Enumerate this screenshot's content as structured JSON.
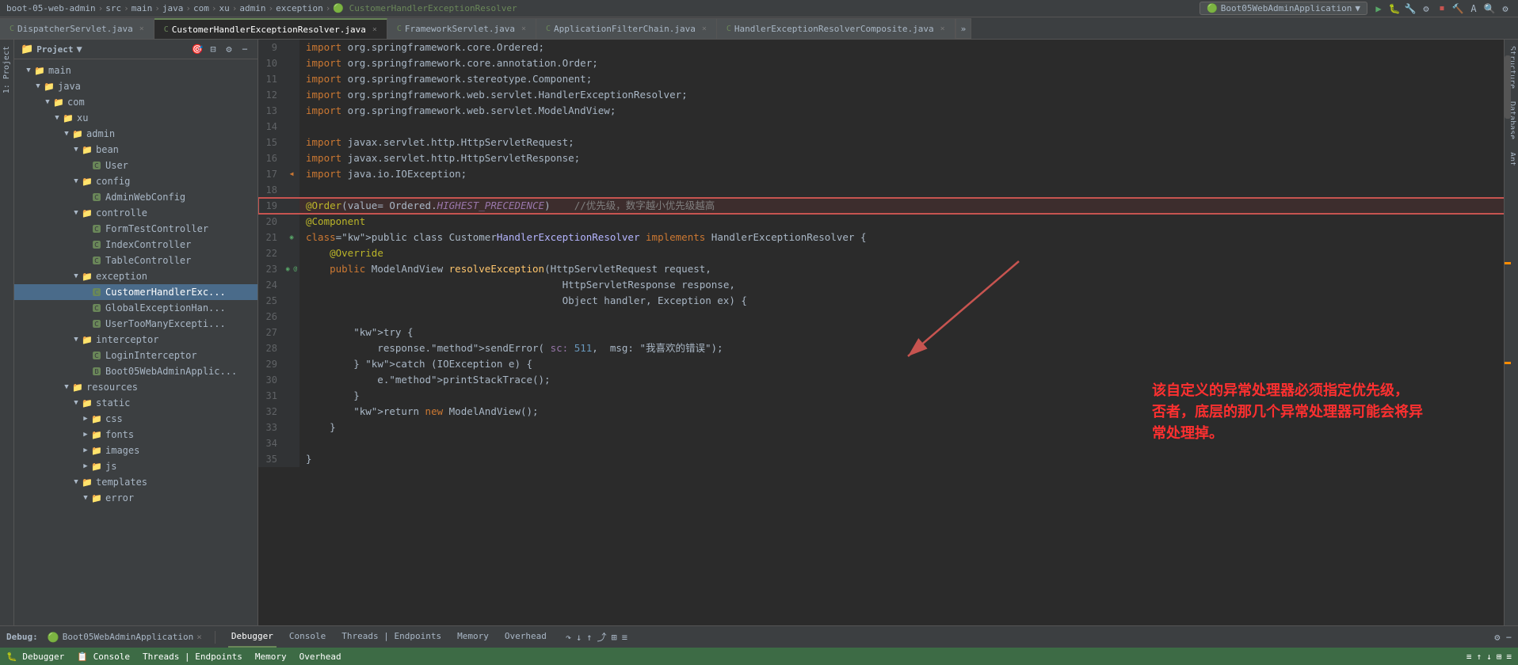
{
  "topbar": {
    "breadcrumb": [
      "boot-05-web-admin",
      "src",
      "main",
      "java",
      "com",
      "xu",
      "admin",
      "exception",
      "CustomerHandlerExceptionResolver"
    ],
    "run_config": "Boot05WebAdminApplication",
    "icons": [
      "▶",
      "⏸",
      "⏹",
      "↺",
      "⚙",
      "📋",
      "🔧",
      "🔍",
      "A"
    ]
  },
  "tabs": [
    {
      "label": "DispatcherServlet.java",
      "active": false,
      "icon": "C"
    },
    {
      "label": "CustomerHandlerExceptionResolver.java",
      "active": true,
      "icon": "C"
    },
    {
      "label": "FrameworkServlet.java",
      "active": false,
      "icon": "C"
    },
    {
      "label": "ApplicationFilterChain.java",
      "active": false,
      "icon": "C"
    },
    {
      "label": "HandlerExceptionResolverComposite.java",
      "active": false,
      "icon": "C"
    }
  ],
  "sidebar": {
    "title": "Project",
    "tree": [
      {
        "label": "main",
        "type": "folder",
        "indent": 1,
        "expanded": true,
        "arrow": "▼"
      },
      {
        "label": "java",
        "type": "folder",
        "indent": 2,
        "expanded": true,
        "arrow": "▼"
      },
      {
        "label": "com",
        "type": "folder",
        "indent": 3,
        "expanded": true,
        "arrow": "▼"
      },
      {
        "label": "xu",
        "type": "folder",
        "indent": 4,
        "expanded": true,
        "arrow": "▼"
      },
      {
        "label": "admin",
        "type": "folder",
        "indent": 5,
        "expanded": true,
        "arrow": "▼"
      },
      {
        "label": "bean",
        "type": "folder",
        "indent": 6,
        "expanded": true,
        "arrow": "▼"
      },
      {
        "label": "User",
        "type": "java-c",
        "indent": 7,
        "arrow": ""
      },
      {
        "label": "config",
        "type": "folder",
        "indent": 6,
        "expanded": true,
        "arrow": "▼"
      },
      {
        "label": "AdminWebConfig",
        "type": "java-c",
        "indent": 7,
        "arrow": ""
      },
      {
        "label": "controlle",
        "type": "folder",
        "indent": 6,
        "expanded": true,
        "arrow": "▼"
      },
      {
        "label": "FormTestController",
        "type": "java-c",
        "indent": 7,
        "arrow": ""
      },
      {
        "label": "IndexController",
        "type": "java-c",
        "indent": 7,
        "arrow": ""
      },
      {
        "label": "TableController",
        "type": "java-c",
        "indent": 7,
        "arrow": ""
      },
      {
        "label": "exception",
        "type": "folder",
        "indent": 6,
        "expanded": true,
        "arrow": "▼"
      },
      {
        "label": "CustomerHandlerExc...",
        "type": "java-c",
        "indent": 7,
        "arrow": "",
        "selected": true
      },
      {
        "label": "GlobalExceptionHan...",
        "type": "java-c",
        "indent": 7,
        "arrow": ""
      },
      {
        "label": "UserTooManyExcepti...",
        "type": "java-c",
        "indent": 7,
        "arrow": ""
      },
      {
        "label": "interceptor",
        "type": "folder",
        "indent": 6,
        "expanded": true,
        "arrow": "▼"
      },
      {
        "label": "LoginInterceptor",
        "type": "java-c",
        "indent": 7,
        "arrow": ""
      },
      {
        "label": "Boot05WebAdminApplic...",
        "type": "java-spring",
        "indent": 7,
        "arrow": ""
      },
      {
        "label": "resources",
        "type": "folder",
        "indent": 5,
        "expanded": true,
        "arrow": "▼"
      },
      {
        "label": "static",
        "type": "folder",
        "indent": 6,
        "expanded": true,
        "arrow": "▼"
      },
      {
        "label": "css",
        "type": "folder",
        "indent": 7,
        "expanded": false,
        "arrow": "▶"
      },
      {
        "label": "fonts",
        "type": "folder",
        "indent": 7,
        "expanded": false,
        "arrow": "▶"
      },
      {
        "label": "images",
        "type": "folder",
        "indent": 7,
        "expanded": false,
        "arrow": "▶"
      },
      {
        "label": "js",
        "type": "folder",
        "indent": 7,
        "expanded": false,
        "arrow": "▶"
      },
      {
        "label": "templates",
        "type": "folder",
        "indent": 6,
        "expanded": true,
        "arrow": "▼"
      },
      {
        "label": "error",
        "type": "folder",
        "indent": 7,
        "expanded": false,
        "arrow": "▼"
      }
    ]
  },
  "code": {
    "lines": [
      {
        "num": 9,
        "gutter": "",
        "code": "import org.springframework.core.Ordered;",
        "type": "import"
      },
      {
        "num": 10,
        "gutter": "",
        "code": "import org.springframework.core.annotation.Order;",
        "type": "import"
      },
      {
        "num": 11,
        "gutter": "",
        "code": "import org.springframework.stereotype.Component;",
        "type": "import"
      },
      {
        "num": 12,
        "gutter": "",
        "code": "import org.springframework.web.servlet.HandlerExceptionResolver;",
        "type": "import"
      },
      {
        "num": 13,
        "gutter": "",
        "code": "import org.springframework.web.servlet.ModelAndView;",
        "type": "import"
      },
      {
        "num": 14,
        "gutter": "",
        "code": "",
        "type": "empty"
      },
      {
        "num": 15,
        "gutter": "",
        "code": "import javax.servlet.http.HttpServletRequest;",
        "type": "import"
      },
      {
        "num": 16,
        "gutter": "",
        "code": "import javax.servlet.http.HttpServletResponse;",
        "type": "import"
      },
      {
        "num": 17,
        "gutter": "◀",
        "code": "import java.io.IOException;",
        "type": "import"
      },
      {
        "num": 18,
        "gutter": "",
        "code": "",
        "type": "empty"
      },
      {
        "num": 19,
        "gutter": "",
        "code": "@Order(value= Ordered.HIGHEST_PRECEDENCE)    //优先级，数字越小优先级越高",
        "type": "annotation-highlight"
      },
      {
        "num": 20,
        "gutter": "",
        "code": "@Component",
        "type": "annotation"
      },
      {
        "num": 21,
        "gutter": "◉",
        "code": "public class CustomerHandlerExceptionResolver implements HandlerExceptionResolver {",
        "type": "class"
      },
      {
        "num": 22,
        "gutter": "",
        "code": "    @Override",
        "type": "override"
      },
      {
        "num": 23,
        "gutter": "◉ @",
        "code": "    public ModelAndView resolveException(HttpServletRequest request,",
        "type": "method"
      },
      {
        "num": 24,
        "gutter": "",
        "code": "                                           HttpServletResponse response,",
        "type": "param"
      },
      {
        "num": 25,
        "gutter": "",
        "code": "                                           Object handler, Exception ex) {",
        "type": "param"
      },
      {
        "num": 26,
        "gutter": "",
        "code": "",
        "type": "empty"
      },
      {
        "num": 27,
        "gutter": "",
        "code": "        try {",
        "type": "code"
      },
      {
        "num": 28,
        "gutter": "",
        "code": "            response.sendError( sc: 511,  msg: \"我喜欢的错误\");",
        "type": "code"
      },
      {
        "num": 29,
        "gutter": "",
        "code": "        } catch (IOException e) {",
        "type": "code"
      },
      {
        "num": 30,
        "gutter": "",
        "code": "            e.printStackTrace();",
        "type": "code"
      },
      {
        "num": 31,
        "gutter": "",
        "code": "        }",
        "type": "code"
      },
      {
        "num": 32,
        "gutter": "",
        "code": "        return new ModelAndView();",
        "type": "code"
      },
      {
        "num": 33,
        "gutter": "",
        "code": "    }",
        "type": "code"
      },
      {
        "num": 34,
        "gutter": "",
        "code": "",
        "type": "empty"
      },
      {
        "num": 35,
        "gutter": "",
        "code": "}",
        "type": "code"
      }
    ]
  },
  "annotation": {
    "text_line1": "该自定义的异常处理器必须指定优先级，",
    "text_line2": "否者，底层的那几个异常处理器可能会将异",
    "text_line3": "常处理掉。"
  },
  "debug": {
    "label": "Debug:",
    "app_name": "Boot05WebAdminApplication",
    "tabs": [
      "Debugger",
      "Console",
      "Threads | Endpoints",
      "Memory",
      "Overhead"
    ],
    "active_tab": "Debugger"
  },
  "bottom_status": {
    "items": [
      "Debugger",
      "Console",
      "Threads | Endpoints",
      "Memory",
      "Overhead"
    ]
  },
  "right_tabs": [
    "Structure",
    "Database",
    "Ant"
  ],
  "left_tab": "1: Project"
}
